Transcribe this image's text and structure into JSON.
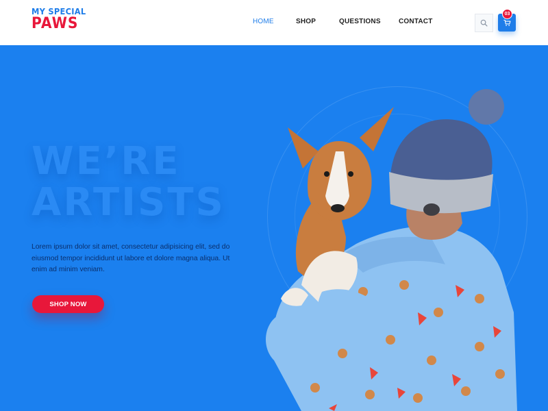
{
  "logo": {
    "line1": "MY SPECIAL",
    "line2": "PAWS"
  },
  "nav": {
    "items": [
      {
        "label": "HOME",
        "active": true
      },
      {
        "label": "SHOP",
        "active": false
      },
      {
        "label": "QUESTIONS",
        "active": false
      },
      {
        "label": "CONTACT",
        "active": false
      }
    ]
  },
  "header_actions": {
    "search_icon": "search-icon",
    "cart_icon": "cart-icon",
    "cart_count": "03"
  },
  "hero": {
    "headline_line1": "WE’RE",
    "headline_line2": "ARTISTS",
    "description": "Lorem ipsum dolor sit amet, consectetur adipisicing elit, sed do eiusmod tempor incididunt ut labore et dolore magna aliqua. Ut enim ad minim veniam.",
    "cta_label": "SHOP NOW",
    "photo": "person-in-beanie-holding-corgi"
  },
  "colors": {
    "brand_blue": "#1e7de9",
    "brand_red": "#e8173a",
    "hero_bg": "#1b80ef"
  }
}
